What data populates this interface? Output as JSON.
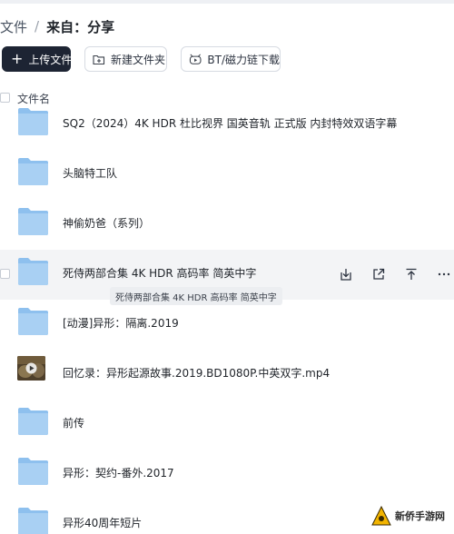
{
  "breadcrumb": {
    "root": "文件",
    "separator": "/",
    "current": "来自：分享"
  },
  "toolbar": {
    "upload_label": "上传文件",
    "new_folder_label": "新建文件夹",
    "bt_label": "BT/磁力链下载"
  },
  "list": {
    "column_header": "文件名",
    "items": [
      {
        "name": "SQ2（2024）4K HDR 杜比视界 国英音轨 正式版 内封特效双语字幕",
        "icon": "folder-icon"
      },
      {
        "name": "头脑特工队",
        "icon": "folder-icon"
      },
      {
        "name": "神偷奶爸（系列）",
        "icon": "folder-icon"
      },
      {
        "name": "死侍两部合集 4K HDR 高码率 简英中字",
        "icon": "folder-icon"
      },
      {
        "name": "[动漫]异形：隔离.2019",
        "icon": "folder-icon"
      },
      {
        "name": "回忆录：异形起源故事.2019.BD1080P.中英双字.mp4",
        "icon": "video-thumbnail"
      },
      {
        "name": "前传",
        "icon": "folder-icon"
      },
      {
        "name": "异形：契约-番外.2017",
        "icon": "folder-icon"
      },
      {
        "name": "异形40周年短片",
        "icon": "folder-icon"
      }
    ]
  },
  "tooltip": {
    "text": "死侍两部合集 4K HDR 高码率 简英中字"
  },
  "row_actions": [
    "download-icon",
    "share-icon",
    "move-top-icon",
    "more-icon"
  ],
  "watermark": {
    "text": "新侨手游网"
  },
  "colors": {
    "primary_button": "#1d2433",
    "folder": "#8ec0ee",
    "hover_row": "#f3f4f6"
  }
}
